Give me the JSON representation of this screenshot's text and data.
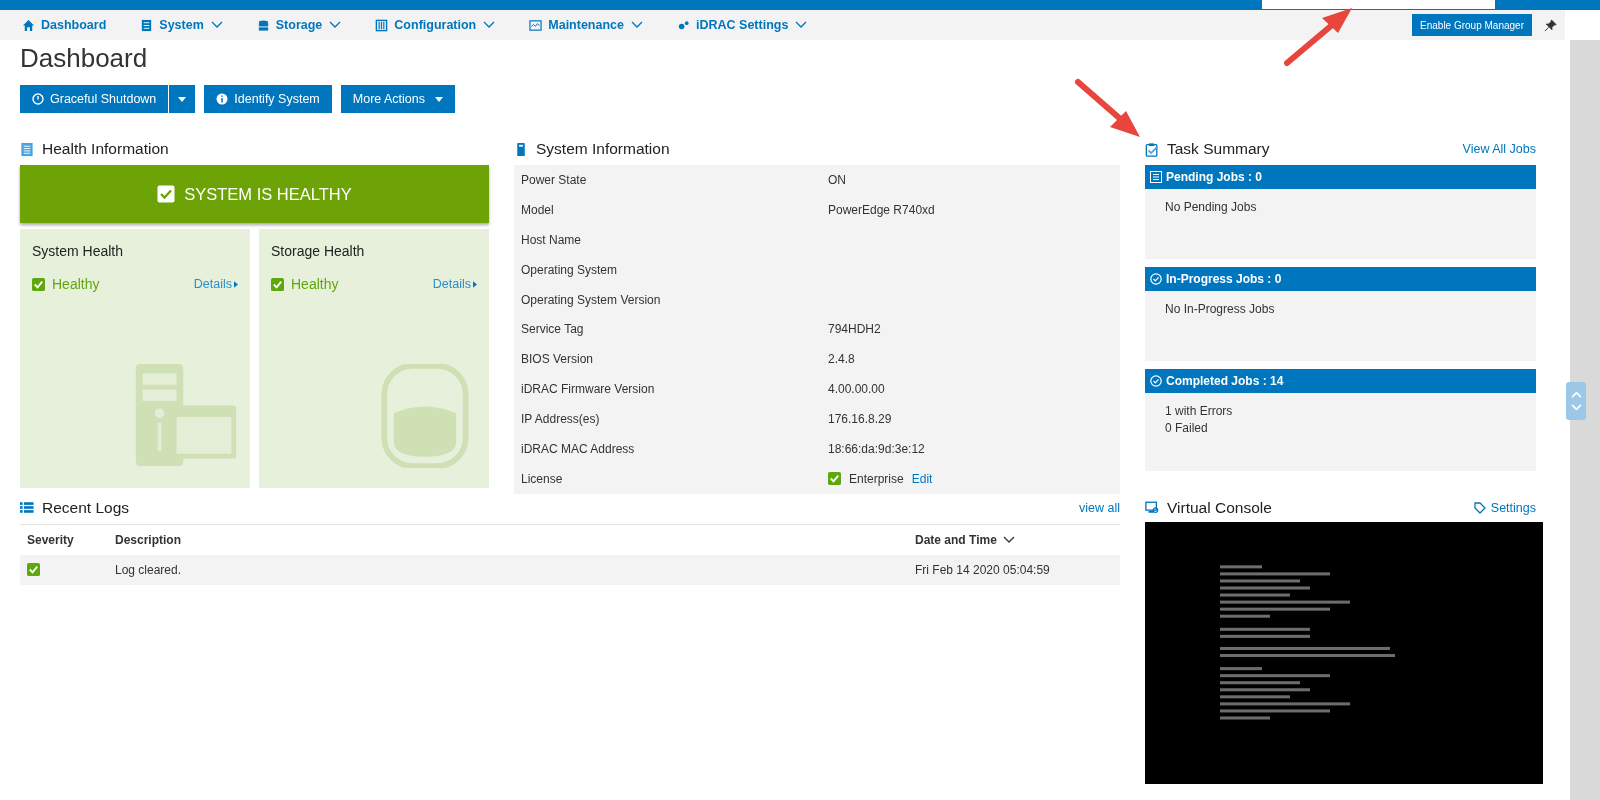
{
  "top_nav": {
    "items": [
      {
        "label": "Dashboard",
        "dropdown": false
      },
      {
        "label": "System",
        "dropdown": true
      },
      {
        "label": "Storage",
        "dropdown": true
      },
      {
        "label": "Configuration",
        "dropdown": true
      },
      {
        "label": "Maintenance",
        "dropdown": true
      },
      {
        "label": "iDRAC Settings",
        "dropdown": true
      }
    ],
    "group_manager_button": "Enable Group Manager"
  },
  "page_title": "Dashboard",
  "actions": [
    {
      "label": "Graceful Shutdown",
      "kind": "split"
    },
    {
      "label": "Identify System",
      "kind": "info"
    },
    {
      "label": "More Actions",
      "kind": "menu"
    }
  ],
  "health": {
    "title": "Health Information",
    "banner": "SYSTEM IS HEALTHY",
    "cards": [
      {
        "title": "System Health",
        "status": "Healthy",
        "details": "Details",
        "kind": "server"
      },
      {
        "title": "Storage Health",
        "status": "Healthy",
        "details": "Details",
        "kind": "disk"
      }
    ]
  },
  "system_info": {
    "title": "System Information",
    "rows": [
      {
        "label": "Power State",
        "value": "ON"
      },
      {
        "label": "Model",
        "value": "PowerEdge R740xd"
      },
      {
        "label": "Host Name"
      },
      {
        "label": "Operating System"
      },
      {
        "label": "Operating System Version"
      },
      {
        "label": "Service Tag",
        "value": "794HDH2"
      },
      {
        "label": "BIOS Version",
        "value": "2.4.8"
      },
      {
        "label": "iDRAC Firmware Version",
        "value": "4.00.00.00"
      },
      {
        "label": "IP Address(es)",
        "value": "176.16.8.29"
      },
      {
        "label": "iDRAC MAC Address",
        "value": "18:66:da:9d:3e:12"
      },
      {
        "label": "License",
        "value": "Enterprise",
        "checked": true,
        "link": "Edit"
      }
    ]
  },
  "task_summary": {
    "title": "Task Summary",
    "view_all": "View All Jobs",
    "sections": [
      {
        "title": "Pending Jobs : 0",
        "kind": "pending",
        "lines": [
          "No Pending Jobs"
        ]
      },
      {
        "title": "In-Progress Jobs : 0",
        "kind": "progress",
        "lines": [
          "No In-Progress Jobs"
        ]
      },
      {
        "title": "Completed Jobs : 14",
        "kind": "done",
        "lines": [
          "1  with Errors",
          "0  Failed"
        ]
      }
    ]
  },
  "recent_logs": {
    "title": "Recent Logs",
    "view_all": "view all",
    "columns": [
      "Severity",
      "Description",
      "Date and Time"
    ],
    "rows": [
      {
        "description": "Log cleared.",
        "date": "Fri Feb 14 2020 05:04:59"
      }
    ]
  },
  "virtual_console": {
    "title": "Virtual Console",
    "settings": "Settings",
    "kind": "picture"
  }
}
